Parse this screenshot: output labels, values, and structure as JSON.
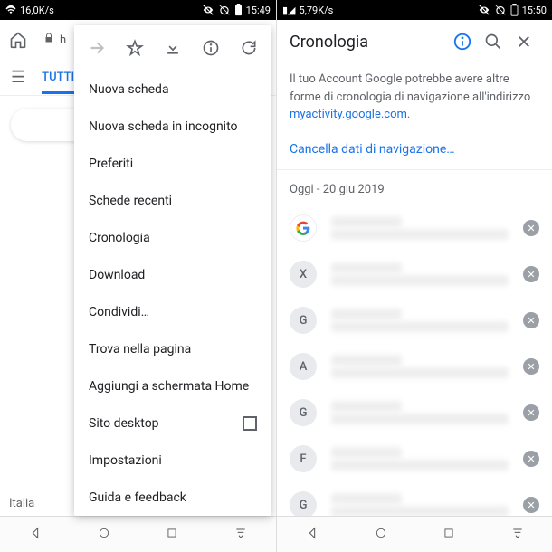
{
  "left": {
    "status": {
      "speed": "16,0K/s",
      "time": "15:49"
    },
    "url_prefix": "h",
    "tab_all": "TUTTI",
    "footer": "Italia",
    "menu": {
      "items": [
        "Nuova scheda",
        "Nuova scheda in incognito",
        "Preferiti",
        "Schede recenti",
        "Cronologia",
        "Download",
        "Condividi…",
        "Trova nella pagina",
        "Aggiungi a schermata Home",
        "Sito desktop",
        "Impostazioni",
        "Guida e feedback"
      ]
    }
  },
  "right": {
    "status": {
      "speed": "5,79K/s",
      "time": "15:50"
    },
    "title": "Cronologia",
    "info_text": "Il tuo Account Google potrebbe avere altre forme di cronologia di navigazione all'indirizzo ",
    "info_link": "myactivity.google.com",
    "clear_label": "Cancella dati di navigazione…",
    "date": "Oggi - 20 giu 2019",
    "items": [
      {
        "letter": "G",
        "google": true
      },
      {
        "letter": "X",
        "google": false
      },
      {
        "letter": "G",
        "google": false
      },
      {
        "letter": "A",
        "google": false
      },
      {
        "letter": "G",
        "google": false
      },
      {
        "letter": "F",
        "google": false
      },
      {
        "letter": "G",
        "google": false
      }
    ]
  }
}
